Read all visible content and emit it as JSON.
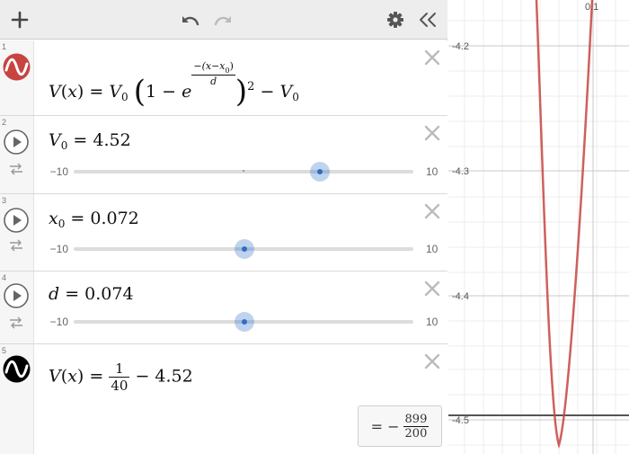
{
  "toolbar": {
    "add_icon": "plus-icon",
    "undo_icon": "undo-icon",
    "redo_icon": "redo-icon",
    "settings_icon": "gear-icon",
    "collapse_icon": "double-chevron-left-icon"
  },
  "expressions": [
    {
      "index": "1",
      "icon": "wave-icon",
      "color": "#c74440",
      "math": {
        "lhs_fn": "V",
        "lhs_var": "x",
        "v0": "V",
        "v0_sub": "0",
        "one": "1",
        "minus": "−",
        "e": "e",
        "exp_num": "−(x−x",
        "exp_num_sub": "0",
        "exp_num_end": ")",
        "exp_den": "d",
        "power": "2",
        "tail": "V",
        "tail_sub": "0"
      }
    },
    {
      "index": "2",
      "name": "V",
      "sub": "0",
      "value": "4.52",
      "slider": {
        "min": "−10",
        "max": "10",
        "min_value": -10,
        "max_value": 10,
        "current": 4.52,
        "marker": 0
      }
    },
    {
      "index": "3",
      "name": "x",
      "sub": "0",
      "value": "0.072",
      "slider": {
        "min": "−10",
        "max": "10",
        "min_value": -10,
        "max_value": 10,
        "current": 0.072
      }
    },
    {
      "index": "4",
      "name": "d",
      "sub": "",
      "value": "0.074",
      "slider": {
        "min": "−10",
        "max": "10",
        "min_value": -10,
        "max_value": 10,
        "current": 0.074
      }
    },
    {
      "index": "5",
      "icon": "wave-icon",
      "color": "#000000",
      "math": {
        "lhs_fn": "V",
        "lhs_var": "x",
        "num": "1",
        "den": "40",
        "minus": "−",
        "const": "4.52"
      },
      "result": {
        "sign": "= −",
        "num": "899",
        "den": "200"
      }
    }
  ],
  "graph": {
    "x_tick_label": "0.1",
    "y_tick_labels": [
      "-4.2",
      "-4.3",
      "-4.4",
      "-4.5"
    ],
    "curve_color": "#c74440",
    "line_color": "#000000",
    "horizontal_line_y": -4.495
  }
}
